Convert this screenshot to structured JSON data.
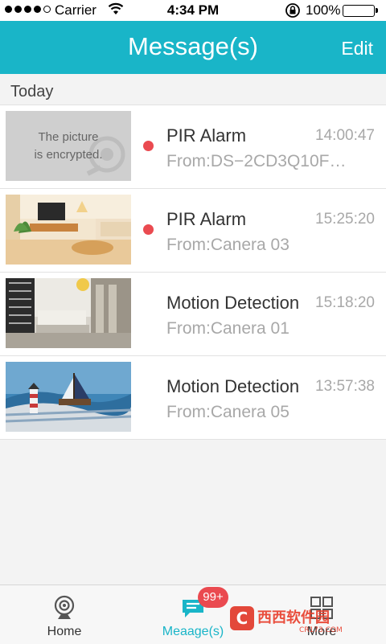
{
  "status_bar": {
    "carrier": "Carrier",
    "time": "4:34 PM",
    "battery": "100%"
  },
  "nav": {
    "title": "Message(s)",
    "edit_label": "Edit"
  },
  "section": {
    "label": "Today"
  },
  "messages": [
    {
      "encrypted_text_line1": "The picture",
      "encrypted_text_line2": "is encrypted.",
      "title": "PIR Alarm",
      "from": "From:DS−2CD3Q10F…",
      "time": "14:00:47",
      "unread": true
    },
    {
      "title": "PIR Alarm",
      "from": "From:Canera 03",
      "time": "15:25:20",
      "unread": true
    },
    {
      "title": "Motion Detection",
      "from": "From:Canera 01",
      "time": "15:18:20",
      "unread": false
    },
    {
      "title": "Motion Detection",
      "from": "From:Canera 05",
      "time": "13:57:38",
      "unread": false
    }
  ],
  "tabs": {
    "home": "Home",
    "messages": "Meaage(s)",
    "more": "More",
    "badge": "99+"
  },
  "colors": {
    "accent": "#19b5c8",
    "unread_dot": "#ea4a50",
    "badge": "#ea4a50"
  },
  "watermark": {
    "text": "西西软件园",
    "url": "CR173.COM"
  }
}
